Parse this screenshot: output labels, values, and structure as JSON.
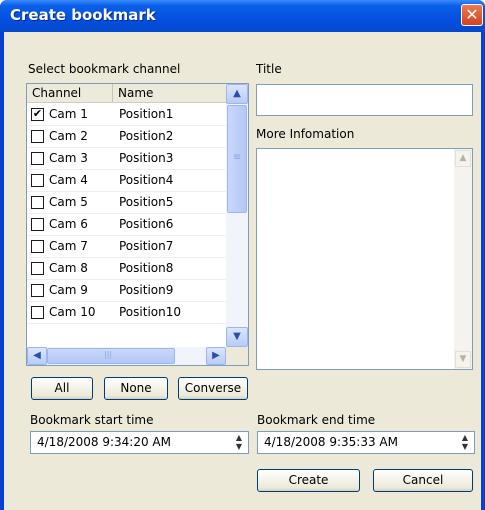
{
  "window": {
    "title": "Create bookmark",
    "close_glyph": "✕"
  },
  "channel_section": {
    "label": "Select bookmark channel",
    "columns": [
      "Channel",
      "Name"
    ],
    "rows": [
      {
        "checked": true,
        "check": "✔",
        "channel": "Cam 1",
        "name": "Position1"
      },
      {
        "checked": false,
        "check": "",
        "channel": "Cam 2",
        "name": "Position2"
      },
      {
        "checked": false,
        "check": "",
        "channel": "Cam 3",
        "name": "Position3"
      },
      {
        "checked": false,
        "check": "",
        "channel": "Cam 4",
        "name": "Position4"
      },
      {
        "checked": false,
        "check": "",
        "channel": "Cam 5",
        "name": "Position5"
      },
      {
        "checked": false,
        "check": "",
        "channel": "Cam 6",
        "name": "Position6"
      },
      {
        "checked": false,
        "check": "",
        "channel": "Cam 7",
        "name": "Position7"
      },
      {
        "checked": false,
        "check": "",
        "channel": "Cam 8",
        "name": "Position8"
      },
      {
        "checked": false,
        "check": "",
        "channel": "Cam 9",
        "name": "Position9"
      },
      {
        "checked": false,
        "check": "",
        "channel": "Cam 10",
        "name": "Position10"
      }
    ],
    "scroll": {
      "up": "▲",
      "down": "▼",
      "left": "◀",
      "right": "▶",
      "grip": "≡",
      "hgrip": "|||"
    }
  },
  "select_buttons": {
    "all": "All",
    "none": "None",
    "converse": "Converse"
  },
  "title_field": {
    "label": "Title",
    "value": ""
  },
  "info_field": {
    "label": "More Infomation",
    "value": "",
    "up": "▲",
    "down": "▼"
  },
  "start_time": {
    "label": "Bookmark start time",
    "value": "4/18/2008   9:34:20 AM",
    "spin_up": "▲",
    "spin_down": "▼"
  },
  "end_time": {
    "label": "Bookmark end time",
    "value": "4/18/2008   9:35:33 AM",
    "spin_up": "▲",
    "spin_down": "▼"
  },
  "actions": {
    "create": "Create",
    "cancel": "Cancel"
  }
}
